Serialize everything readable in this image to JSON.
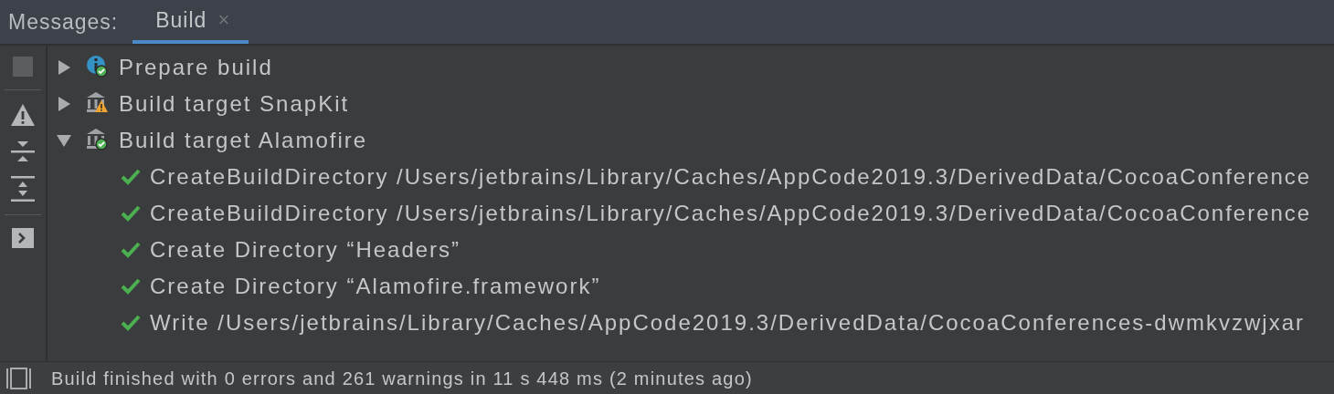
{
  "header": {
    "label": "Messages:",
    "tabs": [
      {
        "label": "Build",
        "selected": true,
        "close": "×"
      }
    ]
  },
  "toolbar": [
    {
      "kind": "stop"
    },
    {
      "kind": "sep"
    },
    {
      "kind": "warning"
    },
    {
      "kind": "collapse"
    },
    {
      "kind": "expand"
    },
    {
      "kind": "sep"
    },
    {
      "kind": "console"
    }
  ],
  "tree": [
    {
      "label": "Prepare build",
      "kind": "info",
      "warning": false,
      "expanded": false
    },
    {
      "label": "Build target SnapKit",
      "kind": "target",
      "warning": true,
      "expanded": false
    },
    {
      "label": "Build target Alamofire",
      "kind": "target",
      "warning": false,
      "expanded": true,
      "children": [
        {
          "label": "CreateBuildDirectory /Users/jetbrains/Library/Caches/AppCode2019.3/DerivedData/CocoaConference",
          "done": true
        },
        {
          "label": "CreateBuildDirectory /Users/jetbrains/Library/Caches/AppCode2019.3/DerivedData/CocoaConference",
          "done": true
        },
        {
          "label": "Create Directory “Headers”",
          "done": true
        },
        {
          "label": "Create Directory “Alamofire.framework”",
          "done": true
        },
        {
          "label": "Write /Users/jetbrains/Library/Caches/AppCode2019.3/DerivedData/CocoaConferences-dwmkvzwjxar",
          "done": true
        }
      ]
    }
  ],
  "status_bar": {
    "text": "Build finished with 0 errors and 261 warnings in 11 s 448 ms (2 minutes ago)"
  }
}
